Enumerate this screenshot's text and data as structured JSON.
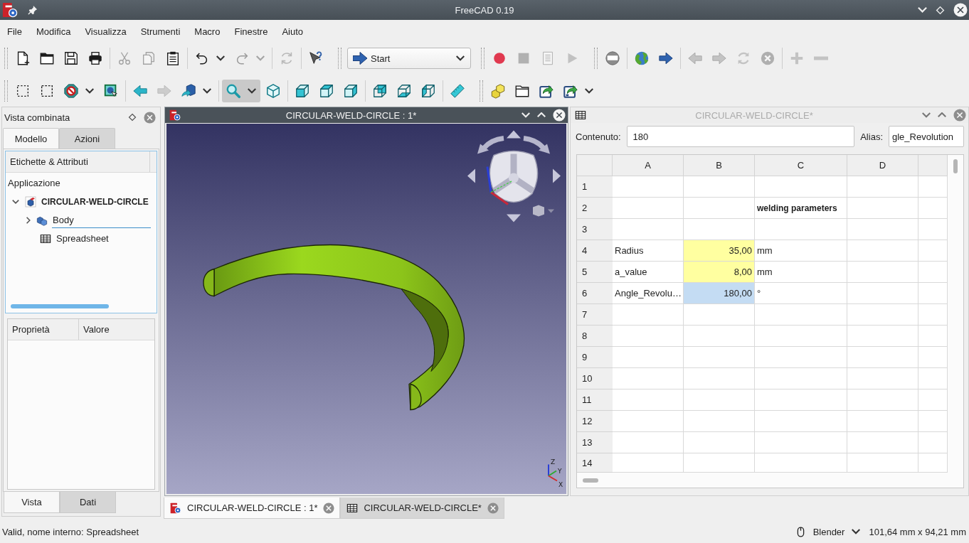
{
  "window": {
    "title": "FreeCAD 0.19"
  },
  "menu": [
    "File",
    "Modifica",
    "Visualizza",
    "Strumenti",
    "Macro",
    "Finestre",
    "Aiuto"
  ],
  "toolbar_rows": [
    [
      {
        "kind": "buttons",
        "groups": [
          [
            {
              "kind": "new",
              "disabled": false,
              "pressed": false
            },
            {
              "kind": "open",
              "disabled": false,
              "pressed": false
            },
            {
              "kind": "save",
              "disabled": false,
              "pressed": false
            },
            {
              "kind": "print",
              "disabled": false,
              "pressed": false
            }
          ],
          [
            {
              "kind": "cut",
              "disabled": true,
              "pressed": false
            },
            {
              "kind": "copy",
              "disabled": true,
              "pressed": false
            },
            {
              "kind": "paste",
              "disabled": false,
              "pressed": false
            }
          ],
          [
            {
              "kind": "undo",
              "disabled": false,
              "pressed": false,
              "menu": true
            },
            {
              "kind": "redo",
              "disabled": true,
              "pressed": false,
              "menu": true
            }
          ],
          [
            {
              "kind": "refresh",
              "disabled": true,
              "pressed": false
            }
          ],
          [
            {
              "kind": "whatsthis",
              "disabled": false,
              "pressed": false
            }
          ]
        ]
      },
      {
        "kind": "workbench",
        "label": "Start"
      },
      {
        "kind": "buttons",
        "groups": [
          [
            {
              "kind": "record",
              "disabled": false,
              "pressed": false
            },
            {
              "kind": "stop",
              "disabled": true,
              "pressed": false
            },
            {
              "kind": "macro",
              "disabled": true,
              "pressed": false
            },
            {
              "kind": "play",
              "disabled": true,
              "pressed": false
            }
          ]
        ]
      },
      {
        "kind": "buttons",
        "groups": [
          [
            {
              "kind": "disc",
              "disabled": false,
              "pressed": false
            }
          ],
          [
            {
              "kind": "globe",
              "disabled": false,
              "pressed": false
            },
            {
              "kind": "go",
              "disabled": false,
              "pressed": false
            }
          ],
          [
            {
              "kind": "back",
              "disabled": true,
              "pressed": false
            },
            {
              "kind": "forward",
              "disabled": true,
              "pressed": false
            },
            {
              "kind": "reload",
              "disabled": true,
              "pressed": false
            },
            {
              "kind": "stopx",
              "disabled": true,
              "pressed": false
            }
          ],
          [
            {
              "kind": "plus",
              "disabled": true,
              "pressed": false
            },
            {
              "kind": "minus",
              "disabled": true,
              "pressed": false
            }
          ]
        ]
      }
    ],
    [
      {
        "kind": "buttons",
        "groups": [
          [
            {
              "kind": "boxsel",
              "disabled": false,
              "pressed": false
            },
            {
              "kind": "boxelsel",
              "disabled": false,
              "pressed": false
            },
            {
              "kind": "visibility",
              "disabled": false,
              "pressed": false,
              "menu": true
            },
            {
              "kind": "selview",
              "disabled": false,
              "pressed": false
            }
          ],
          [
            {
              "kind": "navback",
              "disabled": false,
              "pressed": false
            },
            {
              "kind": "navfwd",
              "disabled": true,
              "pressed": false
            },
            {
              "kind": "stdview",
              "disabled": false,
              "pressed": false,
              "menu": true
            }
          ],
          [
            {
              "kind": "fitall",
              "disabled": false,
              "pressed": true,
              "menu": true
            },
            {
              "kind": "iso",
              "disabled": false,
              "pressed": false
            }
          ],
          [
            {
              "kind": "front",
              "disabled": false,
              "pressed": false
            },
            {
              "kind": "top",
              "disabled": false,
              "pressed": false
            },
            {
              "kind": "right",
              "disabled": false,
              "pressed": false
            }
          ],
          [
            {
              "kind": "rear",
              "disabled": false,
              "pressed": false
            },
            {
              "kind": "bottom",
              "disabled": false,
              "pressed": false
            },
            {
              "kind": "left",
              "disabled": false,
              "pressed": false
            }
          ],
          [
            {
              "kind": "measure",
              "disabled": false,
              "pressed": false
            }
          ]
        ]
      },
      {
        "kind": "buttons",
        "groups": [
          [
            {
              "kind": "part",
              "disabled": false,
              "pressed": false
            },
            {
              "kind": "group",
              "disabled": false,
              "pressed": false
            },
            {
              "kind": "link",
              "disabled": false,
              "pressed": false
            },
            {
              "kind": "linksub",
              "disabled": false,
              "pressed": false,
              "menu": true
            }
          ]
        ]
      }
    ]
  ],
  "combo_view": {
    "title": "Vista combinata",
    "tabs": [
      {
        "label": "Modello",
        "selected": true
      },
      {
        "label": "Azioni",
        "selected": false
      }
    ],
    "tree": {
      "columns": [
        "Etichette & Attributi"
      ],
      "root": "Applicazione",
      "items": [
        {
          "label": "CIRCULAR-WELD-CIRCLE",
          "kind": "document",
          "expanded": true,
          "selected": false,
          "children": [
            {
              "label": "Body",
              "kind": "body",
              "expanded": false,
              "selected": true
            },
            {
              "label": "Spreadsheet",
              "kind": "spreadsheet",
              "selected": false
            }
          ]
        }
      ]
    },
    "properties": {
      "columns": [
        "Proprietà",
        "Valore"
      ]
    },
    "bottom_tabs": [
      {
        "label": "Vista",
        "selected": true
      },
      {
        "label": "Dati",
        "selected": false
      }
    ]
  },
  "windows": [
    {
      "kind": "view3d",
      "title": "CIRCULAR-WELD-CIRCLE : 1*",
      "active": true,
      "axis_labels": [
        "Z",
        "Y",
        "X"
      ]
    },
    {
      "kind": "spreadsheet",
      "title": "CIRCULAR-WELD-CIRCLE*",
      "active": false,
      "content_field": {
        "label": "Contenuto:",
        "value": "180"
      },
      "alias_field": {
        "label": "Alias:",
        "value": "gle_Revolution"
      },
      "columns": [
        "A",
        "B",
        "C",
        "D"
      ],
      "rows": [
        {
          "header": "1",
          "cells": [
            null,
            null,
            null,
            null
          ]
        },
        {
          "header": "2",
          "cells": [
            null,
            null,
            {
              "text": "welding parameters",
              "kind": "heading",
              "selected": false
            },
            null
          ]
        },
        {
          "header": "3",
          "cells": [
            null,
            null,
            null,
            null
          ]
        },
        {
          "header": "4",
          "cells": [
            {
              "text": "Radius",
              "kind": "text",
              "selected": false
            },
            {
              "text": "35,00",
              "kind": "number",
              "color": "#ffffa0",
              "selected": false
            },
            {
              "text": "mm",
              "kind": "text",
              "selected": false
            },
            null
          ]
        },
        {
          "header": "5",
          "cells": [
            {
              "text": "a_value",
              "kind": "text",
              "selected": false
            },
            {
              "text": "8,00",
              "kind": "number",
              "color": "#ffffa0",
              "selected": false
            },
            {
              "text": "mm",
              "kind": "text",
              "selected": false
            },
            null
          ]
        },
        {
          "header": "6",
          "cells": [
            {
              "text": "Angle_Revolu…",
              "kind": "text",
              "selected": false
            },
            {
              "text": "180,00",
              "kind": "number",
              "selected": true
            },
            {
              "text": "°",
              "kind": "text",
              "selected": false
            },
            null
          ]
        },
        {
          "header": "7",
          "cells": [
            null,
            null,
            null,
            null
          ]
        },
        {
          "header": "8",
          "cells": [
            null,
            null,
            null,
            null
          ]
        },
        {
          "header": "9",
          "cells": [
            null,
            null,
            null,
            null
          ]
        },
        {
          "header": "10",
          "cells": [
            null,
            null,
            null,
            null
          ]
        },
        {
          "header": "11",
          "cells": [
            null,
            null,
            null,
            null
          ]
        },
        {
          "header": "12",
          "cells": [
            null,
            null,
            null,
            null
          ]
        },
        {
          "header": "13",
          "cells": [
            null,
            null,
            null,
            null
          ]
        },
        {
          "header": "14",
          "cells": [
            null,
            null,
            null,
            null
          ]
        }
      ]
    }
  ],
  "document_tabs": [
    {
      "label": "CIRCULAR-WELD-CIRCLE : 1*",
      "kind": "view3d",
      "selected": true
    },
    {
      "label": "CIRCULAR-WELD-CIRCLE*",
      "kind": "spreadsheet",
      "selected": false
    }
  ],
  "status_bar": {
    "message": "Valid, nome interno: Spreadsheet",
    "navigation_style": "Blender",
    "dimensions": "101,64 mm x 94,21 mm"
  }
}
